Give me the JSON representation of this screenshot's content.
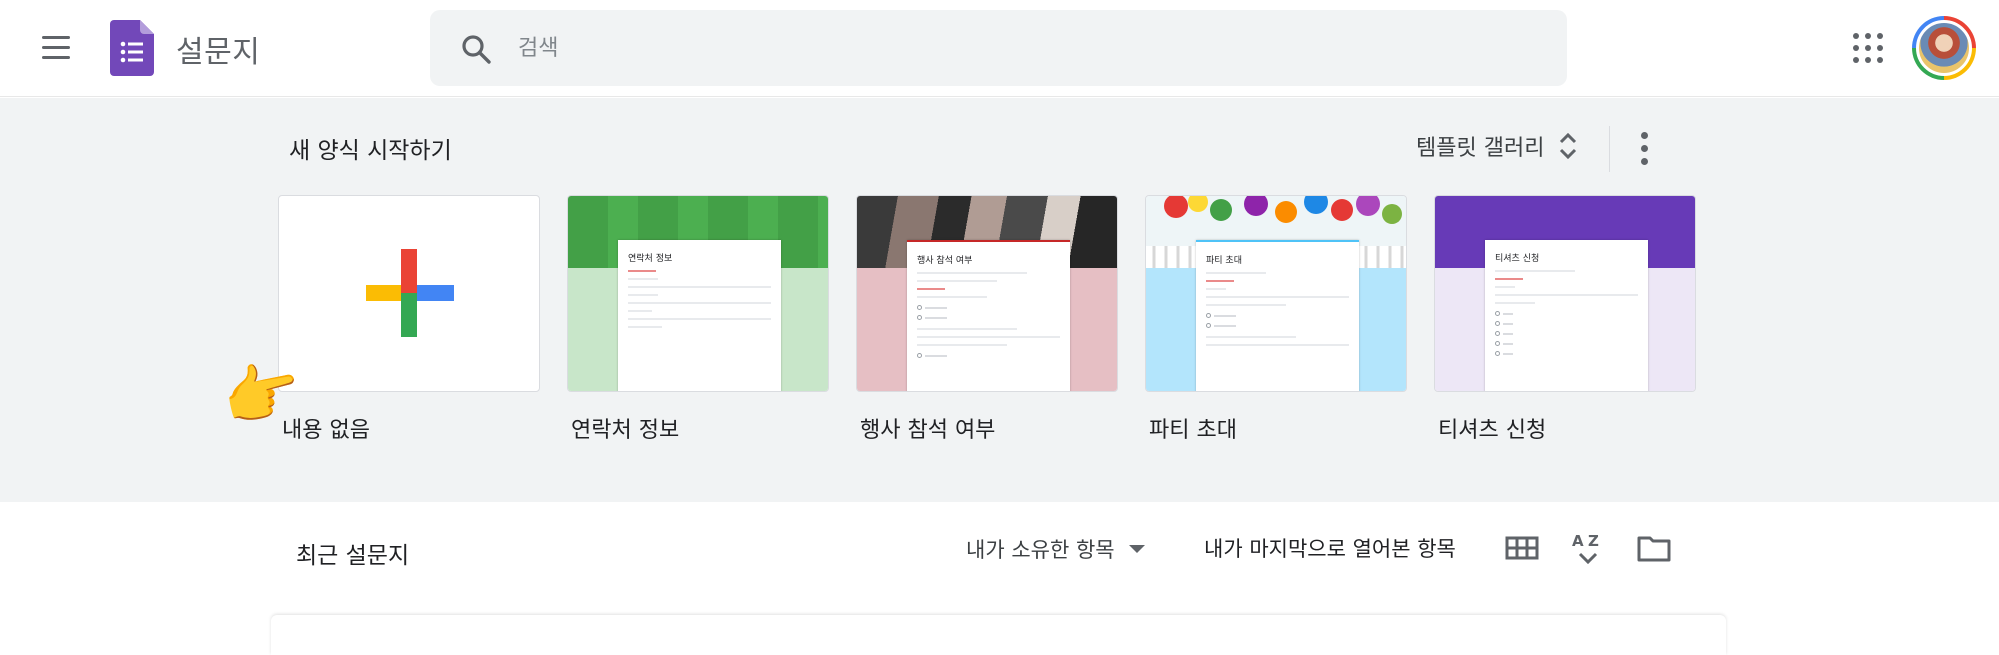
{
  "header": {
    "app_title": "설문지",
    "search_placeholder": "검색"
  },
  "templates": {
    "section_title": "새 양식 시작하기",
    "gallery_label": "템플릿 갤러리",
    "cards": [
      {
        "label": "내용 없음",
        "preview_title": ""
      },
      {
        "label": "연락처 정보",
        "preview_title": "연락처 정보",
        "banner_color": "#43a047",
        "lower_color": "#c8e6c9"
      },
      {
        "label": "행사 참석 여부",
        "preview_title": "행사 참석 여부",
        "lower_color": "#e6bfc4"
      },
      {
        "label": "파티 초대",
        "preview_title": "파티 초대",
        "lower_color": "#b3e5fc"
      },
      {
        "label": "티셔츠 신청",
        "preview_title": "티셔츠 신청",
        "banner_color": "#673ab7",
        "lower_color": "#ede7f6"
      }
    ]
  },
  "recent": {
    "title": "최근 설문지",
    "owner_filter": "내가 소유한 항목",
    "sort_label": "내가 마지막으로 열어본 항목"
  },
  "colors": {
    "forms_purple": "#7248b9",
    "surface_gray": "#f1f3f4",
    "google_red": "#ea4335",
    "google_yellow": "#fbbc04",
    "google_green": "#34a853",
    "google_blue": "#4285f4"
  },
  "icons": {
    "menu": "hamburger-menu-icon",
    "search": "search-icon",
    "apps": "apps-grid-icon",
    "unfold": "unfold-more-icon",
    "more": "more-vert-icon",
    "grid_view": "grid-view-icon",
    "sort_az": "sort-az-icon",
    "folder": "folder-icon",
    "pointer": "pointing-hand-emoji"
  }
}
